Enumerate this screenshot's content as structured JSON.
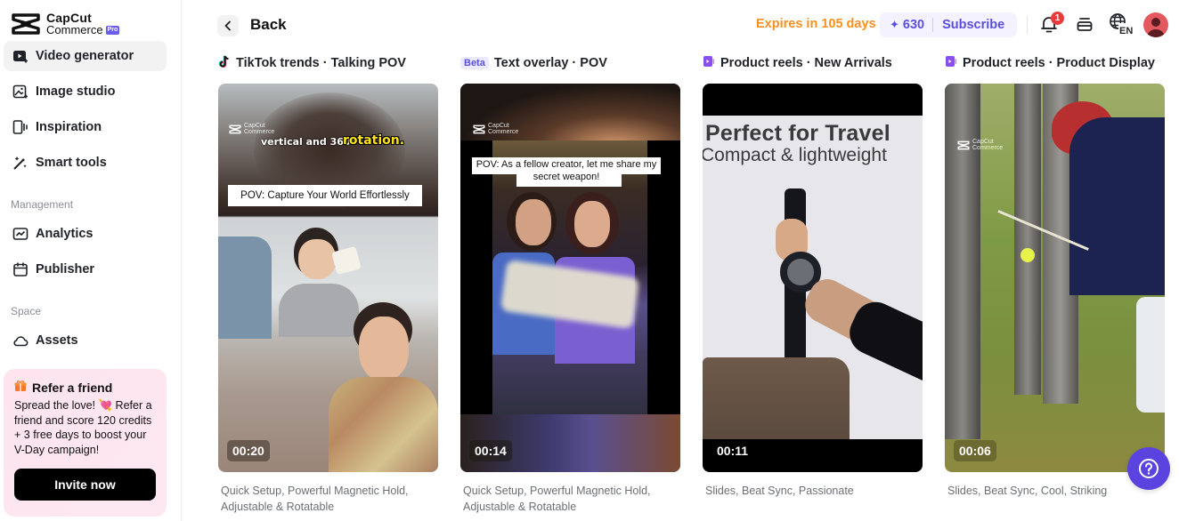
{
  "brand": {
    "name_line1": "CapCut",
    "name_line2": "Commerce",
    "badge": "Pro"
  },
  "sidebar": {
    "items": [
      {
        "label": "Video generator",
        "icon": "video-generator-icon",
        "active": true
      },
      {
        "label": "Image studio",
        "icon": "image-studio-icon",
        "active": false
      },
      {
        "label": "Inspiration",
        "icon": "inspiration-icon",
        "active": false
      },
      {
        "label": "Smart tools",
        "icon": "magic-wand-icon",
        "active": false
      }
    ],
    "management_label": "Management",
    "management_items": [
      {
        "label": "Analytics",
        "icon": "analytics-icon"
      },
      {
        "label": "Publisher",
        "icon": "calendar-icon"
      }
    ],
    "space_label": "Space",
    "space_items": [
      {
        "label": "Assets",
        "icon": "cloud-icon"
      }
    ],
    "refer": {
      "title": "Refer a friend",
      "body": "Spread the love! 💘 Refer a friend and score 120 credits + 3 free days to boost your V-Day campaign!",
      "button": "Invite now"
    }
  },
  "header": {
    "back_label": "Back",
    "expires": "Expires in 105 days",
    "credits": "630",
    "subscribe": "Subscribe",
    "notification_count": "1",
    "language": "EN"
  },
  "cards": [
    {
      "category_icon": "tiktok-icon",
      "title": "TikTok trends · Talking POV",
      "overlay_text": "POV: Capture Your World Effortlessly",
      "caption_a": "vertical and 360°",
      "caption_b": "rotation.",
      "duration": "00:20",
      "description": "Quick Setup, Powerful Magnetic Hold, Adjustable & Rotatable"
    },
    {
      "badge": "Beta",
      "title": "Text overlay · POV",
      "overlay_text": "POV: As a fellow creator, let me share my secret weapon!",
      "duration": "00:14",
      "description": "Quick Setup, Powerful Magnetic Hold, Adjustable & Rotatable"
    },
    {
      "category_icon": "product-reel-icon",
      "title": "Product reels · New Arrivals",
      "headline": "Perfect for Travel",
      "subheadline": "Compact & lightweight",
      "duration": "00:11",
      "description": "Slides, Beat Sync, Passionate"
    },
    {
      "category_icon": "product-reel-icon",
      "title": "Product reels · Product Display",
      "duration": "00:06",
      "description": "Slides, Beat Sync, Cool, Striking"
    }
  ],
  "watermark": {
    "line1": "CapCut",
    "line2": "Commerce"
  },
  "colors": {
    "accent": "#5a4fe0",
    "expires": "#f7901e",
    "notification": "#ea3b3b",
    "help": "#5b43e0",
    "refer_bg": "#fde4ee"
  }
}
